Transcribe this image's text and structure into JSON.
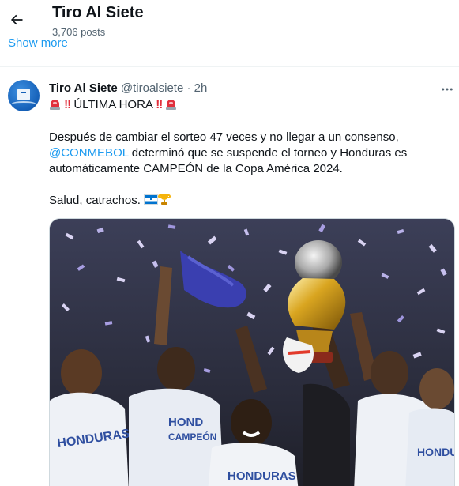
{
  "header": {
    "title": "Tiro Al Siete",
    "subtitle": "3,706 posts",
    "back_icon": "arrow-left-icon"
  },
  "profile": {
    "show_more": "Show more"
  },
  "tweet": {
    "author_name": "Tiro Al Siete",
    "author_handle": "@tiroalsiete",
    "separator": "·",
    "time": "2h",
    "more_icon": "more-horizontal-icon",
    "line1_text": "ÚLTIMA HORA",
    "line1_emojis": [
      "police-light-icon",
      "double-exclamation-icon"
    ],
    "paragraph1_line1": "Después de cambiar el sorteo 47 veces y no llegar a un consenso,",
    "mention": "@CONMEBOL",
    "paragraph1_line2_rest": " determinó que se suspende el torneo y Honduras es",
    "paragraph1_line3": "automáticamente CAMPEÓN de la Copa América 2024.",
    "paragraph2": "Salud, catrachos.",
    "paragraph2_emojis": [
      "honduras-flag-icon",
      "trophy-icon"
    ],
    "media": {
      "alt": "Honduras players lifting a trophy under confetti"
    }
  },
  "colors": {
    "accent": "#1d9bf0",
    "text": "#0f1419",
    "secondary": "#536471",
    "divider": "#eff3f4"
  }
}
